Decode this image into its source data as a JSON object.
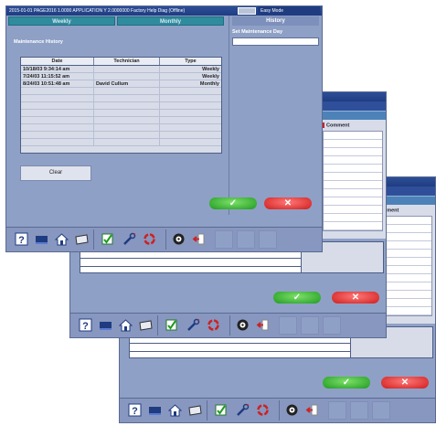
{
  "window": {
    "title_text": "2015-01-01 PAGE2016 1.0000 APPLICATION Y 2.0000000 Factory Help Diag (Offline)",
    "app_label": "Easy Mode"
  },
  "tabs": [
    {
      "label": "Weekly"
    },
    {
      "label": "Monthly"
    }
  ],
  "right_panel": {
    "title": "History",
    "field_label": "Set Maintenance Day",
    "field_value": ""
  },
  "maintenance": {
    "section_title": "Maintenance History",
    "columns": [
      "Date",
      "Technician",
      "Type"
    ],
    "rows": [
      {
        "date": "10/18/03 9:34:14 am",
        "technician": "",
        "type": "Weekly"
      },
      {
        "date": "7/24/03 11:15:52 am",
        "technician": "",
        "type": "Weekly"
      },
      {
        "date": "8/24/03 10:51:48 am",
        "technician": "David Cullum",
        "type": "Monthly"
      },
      {
        "date": "",
        "technician": "",
        "type": ""
      },
      {
        "date": "",
        "technician": "",
        "type": ""
      },
      {
        "date": "",
        "technician": "",
        "type": ""
      },
      {
        "date": "",
        "technician": "",
        "type": ""
      },
      {
        "date": "",
        "technician": "",
        "type": ""
      },
      {
        "date": "",
        "technician": "",
        "type": ""
      },
      {
        "date": "",
        "technician": "",
        "type": ""
      },
      {
        "date": "",
        "technician": "",
        "type": ""
      }
    ],
    "clear_label": "Clear"
  },
  "buttons": {
    "ok_symbol": "✓",
    "cancel_symbol": "✕"
  },
  "background_windows": {
    "win2_comment_header": "Comment",
    "win3_comment_header": "Comment"
  },
  "toolbar_icons": [
    "help-icon",
    "keyboard-icon",
    "home-icon",
    "folder-icon",
    "checklist-icon",
    "wrench-icon",
    "recycle-icon",
    "target-icon",
    "exit-icon"
  ],
  "colors": {
    "window_bg": "#8fa0c6",
    "tab_bg": "#2f8c9f",
    "ok_green": "#1f9a21",
    "cancel_red": "#cf1d1d",
    "titlebar": "#1f3c80"
  }
}
